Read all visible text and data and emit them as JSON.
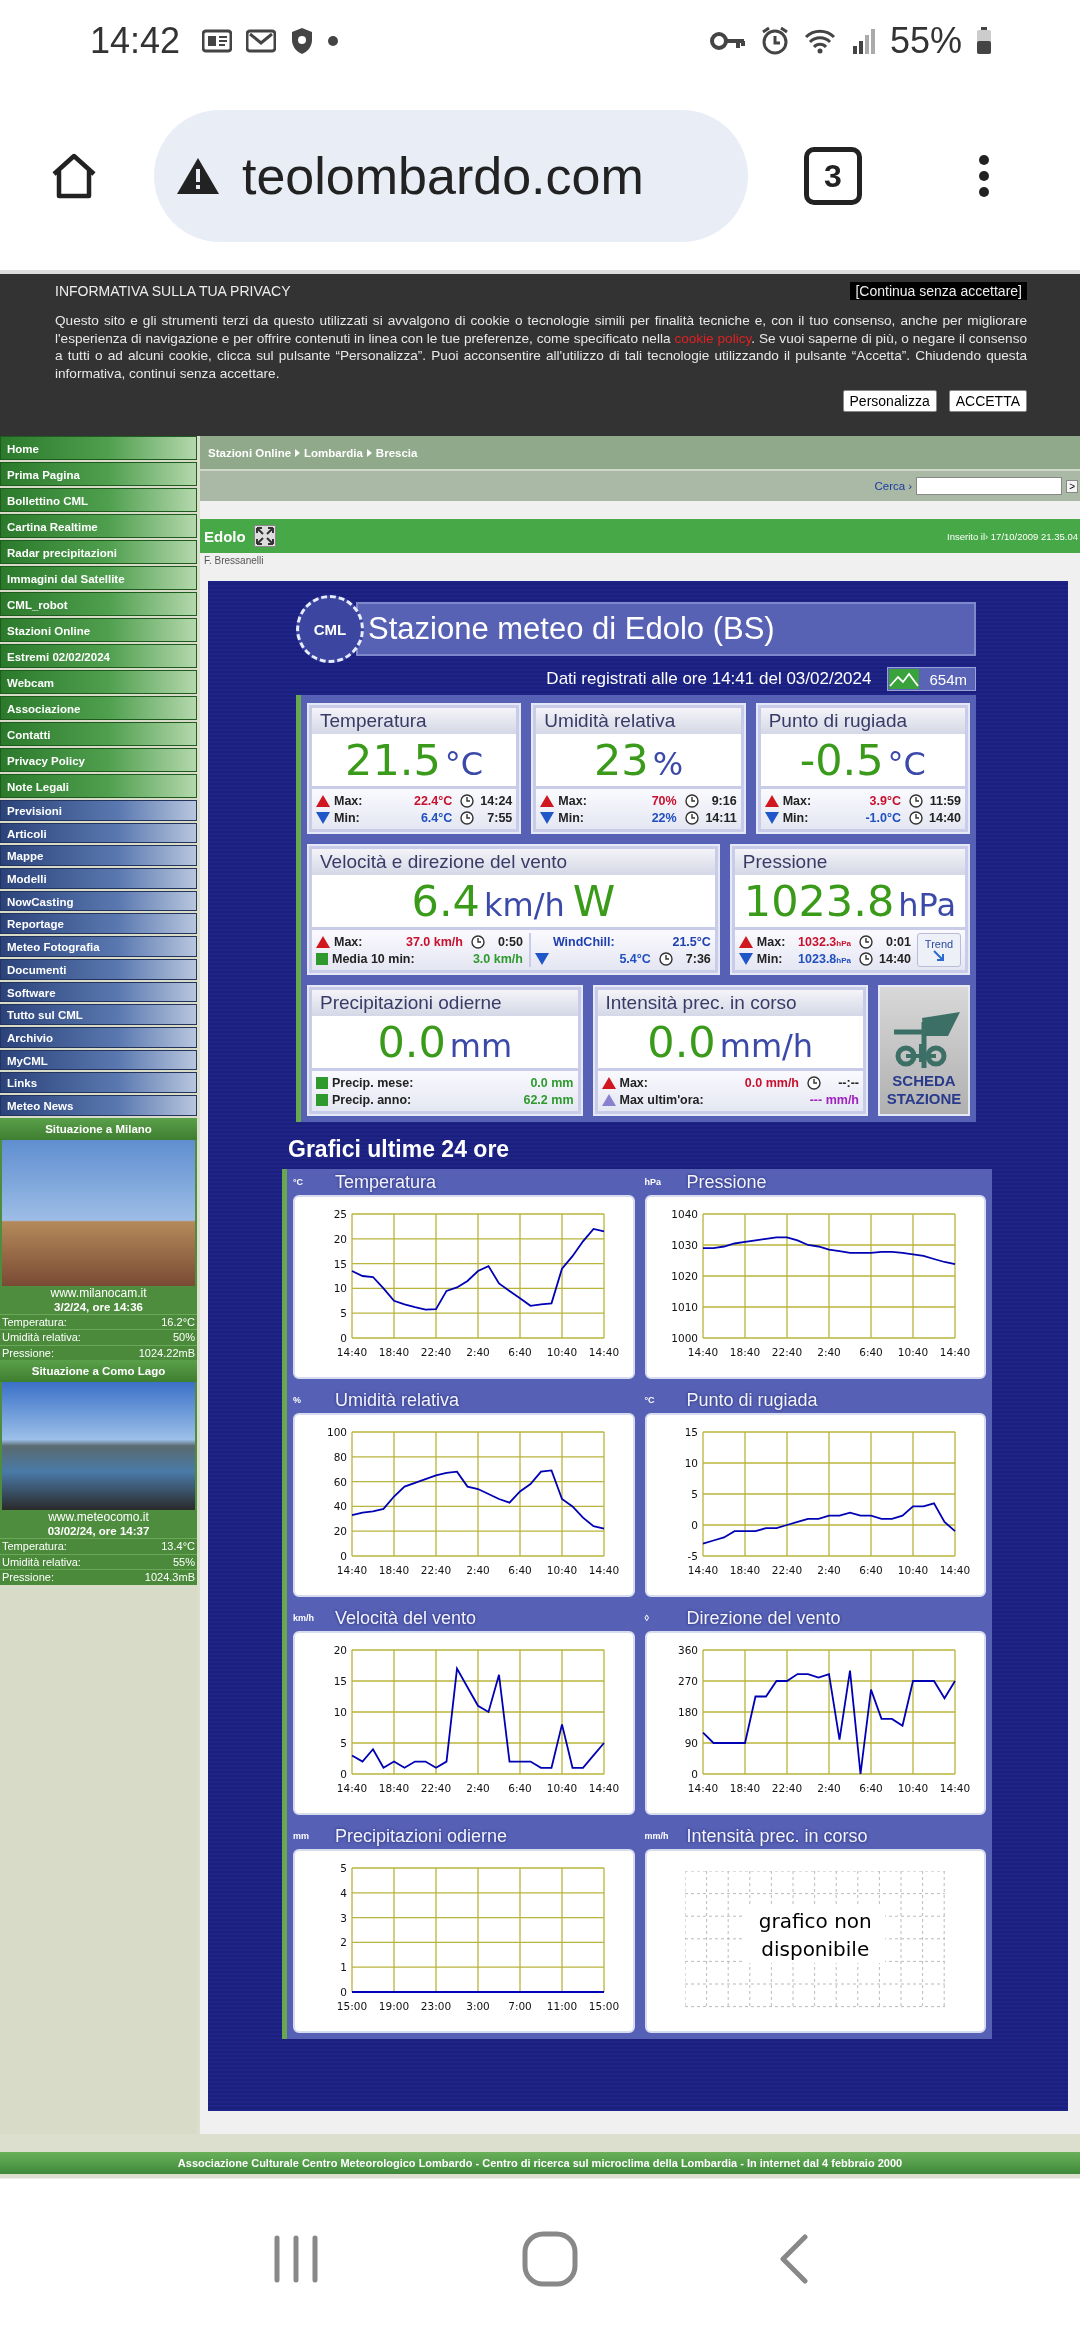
{
  "status_bar": {
    "time": "14:42",
    "battery": "55%"
  },
  "browser": {
    "url": "teolombardo.com",
    "tab_count": "3"
  },
  "privacy_banner": {
    "title": "INFORMATIVA SULLA TUA PRIVACY",
    "dismiss": "[Continua senza accettare]",
    "text_before": "Questo sito e gli strumenti terzi da questo utilizzati si avvalgono di cookie o tecnologie simili per finalità tecniche e, con il tuo consenso, anche per migliorare l'esperienza di navigazione e per offrire contenuti in linea con le tue preferenze, come specificato nella ",
    "link": "cookie policy",
    "text_after": ". Se vuoi saperne di più, o negare il consenso a tutti o ad alcuni cookie, clicca sul pulsante “Personalizza”. Puoi acconsentire all'utilizzo di tali tecnologie utilizzando il pulsante “Accetta”. Chiudendo questa informativa, continui senza accettare.",
    "buttons": [
      "Personalizza",
      "ACCETTA"
    ]
  },
  "sidebar": {
    "menus": [
      {
        "kind": "green",
        "items": [
          "Home",
          "Prima Pagina",
          "Bollettino CML",
          "Cartina Realtime",
          "Radar precipitazioni",
          "Immagini dal Satellite",
          "CML_robot",
          "Stazioni Online",
          "Estremi 02/02/2024",
          "Webcam",
          "Associazione",
          "Contatti",
          "Privacy Policy",
          "Note Legali"
        ]
      },
      {
        "kind": "blue",
        "items": [
          "Previsioni",
          "Articoli",
          "Mappe",
          "Modelli",
          "NowCasting",
          "Reportage",
          "Meteo Fotografia",
          "Documenti",
          "Software",
          "Tutto sul CML",
          "Archivio",
          "MyCML",
          "Links",
          "Meteo News"
        ]
      }
    ],
    "webcams": [
      {
        "title": "Situazione a Milano",
        "site": "www.milanocam.it",
        "datetime": "3/2/24, ore 14:36",
        "readings": [
          {
            "label": "Temperatura:",
            "value": "16.2°C"
          },
          {
            "label": "Umidità relativa:",
            "value": "50%"
          },
          {
            "label": "Pressione:",
            "value": "1024.22mB"
          }
        ]
      },
      {
        "title": "Situazione a Como Lago",
        "site": "www.meteocomo.it",
        "datetime": "03/02/24, ore 14:37",
        "readings": [
          {
            "label": "Temperatura:",
            "value": "13.4°C"
          },
          {
            "label": "Umidità relativa:",
            "value": "55%"
          },
          {
            "label": "Pressione:",
            "value": "1024.3mB"
          }
        ]
      }
    ]
  },
  "breadcrumb": [
    "Stazioni Online",
    "Lombardia",
    "Brescia"
  ],
  "search": {
    "label": "Cerca ›",
    "button": ">"
  },
  "title_bar": {
    "title": "Edolo",
    "inserted": "Inserito il› 17/10/2009 21.35.04"
  },
  "author": "F. Bressanelli",
  "station": {
    "logo": "CML",
    "title": "Stazione meteo di Edolo (BS)",
    "recorded": "Dati registrati alle ore 14:41 del 03/02/2024",
    "altitude": "654m",
    "card_rows": [
      {
        "cards": [
          {
            "kind": "standard",
            "title": "Temperatura",
            "value": "21.5",
            "unit": "°C",
            "stats": [
              {
                "kind": "max",
                "label": "Max:",
                "value": "22.4°C",
                "time": "14:24"
              },
              {
                "kind": "min",
                "label": "Min:",
                "value": "6.4°C",
                "time": "7:55"
              }
            ]
          },
          {
            "kind": "standard",
            "title": "Umidità relativa",
            "value": "23",
            "unit": "%",
            "stats": [
              {
                "kind": "max",
                "label": "Max:",
                "value": "70%",
                "time": "9:16"
              },
              {
                "kind": "min",
                "label": "Min:",
                "value": "22%",
                "time": "14:11"
              }
            ]
          },
          {
            "kind": "standard",
            "title": "Punto di rugiada",
            "value": "-0.5",
            "unit": "°C",
            "stats": [
              {
                "kind": "max",
                "label": "Max:",
                "value": "3.9°C",
                "time": "11:59"
              },
              {
                "kind": "min",
                "label": "Min:",
                "value": "-1.0°C",
                "time": "14:40"
              }
            ]
          }
        ]
      },
      {
        "cards": [
          {
            "kind": "wind",
            "title": "Velocità e direzione del vento",
            "value": "6.4",
            "unit": "km/h",
            "direction": "W",
            "stats": [
              {
                "kind": "max",
                "label": "Max:",
                "value": "37.0 km/h",
                "time": "0:50"
              },
              {
                "kind": "avg",
                "label": "Media 10 min:",
                "value": "3.0 km/h"
              }
            ],
            "side_stats": [
              {
                "kind": "note",
                "label": "WindChill:",
                "value": "21.5°C"
              },
              {
                "kind": "min",
                "value": "5.4°C",
                "time": "7:36"
              }
            ]
          },
          {
            "kind": "pressure",
            "title": "Pressione",
            "value": "1023.8",
            "unit": "hPa",
            "stats": [
              {
                "kind": "max",
                "label": "Max:",
                "value": "1032.3$_{hPa}$",
                "time": "0:01"
              },
              {
                "kind": "min",
                "label": "Min:",
                "value": "1023.8$_{hPa}$",
                "time": "14:40"
              }
            ],
            "trend": "Trend"
          }
        ]
      },
      {
        "cards": [
          {
            "kind": "standard",
            "title": "Precipitazioni odierne",
            "value": "0.0",
            "unit": "mm",
            "stats": [
              {
                "kind": "avg",
                "label": "Precip. mese:",
                "value": "0.0 mm"
              },
              {
                "kind": "avg",
                "label": "Precip. anno:",
                "value": "62.2 mm"
              }
            ]
          },
          {
            "kind": "standard",
            "title": "Intensità prec. in corso",
            "value": "0.0",
            "unit": "mm/h",
            "stats": [
              {
                "kind": "max",
                "label": "Max:",
                "value": "0.0 mm/h",
                "time": "--:--"
              },
              {
                "kind": "recent",
                "label": "Max ultim'ora:",
                "value": "--- mm/h"
              }
            ]
          },
          {
            "kind": "button",
            "label": "SCHEDA STAZIONE"
          }
        ]
      }
    ]
  },
  "charts_title": "Grafici ultime 24 ore",
  "charts": [
    {
      "kind": "chart",
      "title": "Temperatura",
      "unit": "°C",
      "chart_data": {
        "type": "line",
        "grid": true,
        "categories": [
          "14:40",
          null,
          null,
          null,
          "18:40",
          null,
          null,
          null,
          "22:40",
          null,
          null,
          null,
          "2:40",
          null,
          null,
          null,
          "6:40",
          null,
          null,
          null,
          "10:40",
          null,
          null,
          null,
          "14:40"
        ],
        "ylim": [
          0,
          25
        ],
        "yticks": [
          0,
          5,
          10,
          15,
          20,
          25
        ],
        "series": [
          {
            "color": "#0000b4",
            "values": [
              13.5,
              12.5,
              12.3,
              10,
              7.5,
              6.8,
              6.2,
              5.7,
              5.8,
              9.5,
              10.2,
              11.5,
              13.5,
              14.5,
              11,
              9.5,
              8,
              6.5,
              6.8,
              7,
              14,
              16.5,
              19.5,
              22,
              21.5
            ]
          }
        ]
      }
    },
    {
      "kind": "chart",
      "title": "Pressione",
      "unit": "hPa",
      "chart_data": {
        "type": "line",
        "grid": true,
        "categories": [
          "14:40",
          null,
          null,
          null,
          "18:40",
          null,
          null,
          null,
          "22:40",
          null,
          null,
          null,
          "2:40",
          null,
          null,
          null,
          "6:40",
          null,
          null,
          null,
          "10:40",
          null,
          null,
          null,
          "14:40"
        ],
        "ylim": [
          1000,
          1040
        ],
        "yticks": [
          1000,
          1010,
          1020,
          1030,
          1040
        ],
        "series": [
          {
            "color": "#0000b4",
            "values": [
              1029,
              1029,
              1029.5,
              1030.5,
              1031,
              1031.5,
              1032,
              1032.5,
              1032.5,
              1031.5,
              1030,
              1029.5,
              1028.5,
              1028,
              1027.5,
              1027.5,
              1027.5,
              1027.8,
              1027.8,
              1027.5,
              1027,
              1026.5,
              1025.5,
              1024.5,
              1023.8
            ]
          }
        ]
      }
    },
    {
      "kind": "chart",
      "title": "Umidità relativa",
      "unit": "%",
      "chart_data": {
        "type": "line",
        "grid": true,
        "categories": [
          "14:40",
          null,
          null,
          null,
          "18:40",
          null,
          null,
          null,
          "22:40",
          null,
          null,
          null,
          "2:40",
          null,
          null,
          null,
          "6:40",
          null,
          null,
          null,
          "10:40",
          null,
          null,
          null,
          "14:40"
        ],
        "ylim": [
          0,
          100
        ],
        "yticks": [
          0,
          20,
          40,
          60,
          80,
          100
        ],
        "series": [
          {
            "color": "#0000b4",
            "values": [
              33,
              35,
              36,
              38,
              48,
              56,
              59,
              62,
              65,
              67,
              68,
              56,
              54,
              50,
              46,
              43,
              52,
              58,
              68,
              69,
              46,
              40,
              31,
              24,
              22
            ]
          }
        ]
      }
    },
    {
      "kind": "chart",
      "title": "Punto di rugiada",
      "unit": "°C",
      "chart_data": {
        "type": "line",
        "grid": true,
        "categories": [
          "14:40",
          null,
          null,
          null,
          "18:40",
          null,
          null,
          null,
          "22:40",
          null,
          null,
          null,
          "2:40",
          null,
          null,
          null,
          "6:40",
          null,
          null,
          null,
          "10:40",
          null,
          null,
          null,
          "14:40"
        ],
        "ylim": [
          -5,
          15
        ],
        "yticks": [
          -5,
          0,
          5,
          10,
          15
        ],
        "series": [
          {
            "color": "#0000b4",
            "values": [
              -3,
              -2.5,
              -2,
              -1,
              -1,
              -1,
              -0.5,
              -0.5,
              0,
              0.5,
              1,
              1,
              1.5,
              1.5,
              2,
              1.5,
              1.5,
              1,
              1,
              1.5,
              3,
              3,
              3.5,
              0.5,
              -1
            ]
          }
        ]
      }
    },
    {
      "kind": "chart",
      "title": "Velocità del vento",
      "unit": "km/h",
      "chart_data": {
        "type": "line",
        "grid": true,
        "categories": [
          "14:40",
          null,
          null,
          null,
          "18:40",
          null,
          null,
          null,
          "22:40",
          null,
          null,
          null,
          "2:40",
          null,
          null,
          null,
          "6:40",
          null,
          null,
          null,
          "10:40",
          null,
          null,
          null,
          "14:40"
        ],
        "ylim": [
          0,
          20
        ],
        "yticks": [
          0,
          5,
          10,
          15,
          20
        ],
        "series": [
          {
            "color": "#0000b4",
            "values": [
              3,
              2,
              4,
              1,
              2,
              1,
              2,
              2,
              1,
              2,
              17,
              14,
              11,
              10,
              16,
              2,
              2,
              2,
              1,
              1,
              8,
              1,
              1,
              3,
              5
            ]
          }
        ]
      }
    },
    {
      "kind": "chart",
      "title": "Direzione del vento",
      "unit": "◊",
      "chart_data": {
        "type": "line",
        "grid": true,
        "categories": [
          "14:40",
          null,
          null,
          null,
          "18:40",
          null,
          null,
          null,
          "22:40",
          null,
          null,
          null,
          "2:40",
          null,
          null,
          null,
          "6:40",
          null,
          null,
          null,
          "10:40",
          null,
          null,
          null,
          "14:40"
        ],
        "ylim": [
          0,
          360
        ],
        "yticks": [
          0,
          90,
          180,
          270,
          360
        ],
        "series": [
          {
            "color": "#0000b4",
            "values": [
              120,
              90,
              90,
              90,
              90,
              225,
              225,
              270,
              270,
              290,
              290,
              280,
              290,
              100,
              300,
              0,
              245,
              160,
              160,
              140,
              270,
              270,
              270,
              220,
              270
            ]
          }
        ]
      }
    },
    {
      "kind": "chart",
      "title": "Precipitazioni odierne",
      "unit": "mm",
      "chart_data": {
        "type": "line",
        "grid": true,
        "categories": [
          "15:00",
          null,
          null,
          null,
          "19:00",
          null,
          null,
          null,
          "23:00",
          null,
          null,
          null,
          "3:00",
          null,
          null,
          null,
          "7:00",
          null,
          null,
          null,
          "11:00",
          null,
          null,
          null,
          "15:00"
        ],
        "ylim": [
          0,
          5
        ],
        "yticks": [
          0,
          1,
          2,
          3,
          4,
          5
        ],
        "series": [
          {
            "color": "#0000b4",
            "values": [
              0,
              0,
              0,
              0,
              0,
              0,
              0,
              0,
              0,
              0,
              0,
              0,
              0,
              0,
              0,
              0,
              0,
              0,
              0,
              0,
              0,
              0,
              0,
              0,
              0
            ]
          }
        ]
      }
    },
    {
      "kind": "unavailable",
      "title": "Intensità prec. in corso",
      "unit": "mm/h",
      "message": "grafico non disponibile"
    }
  ],
  "footer": "Associazione Culturale Centro Meteorologico Lombardo - Centro di ricerca sul microclima della Lombardia - In internet dal 4 febbraio 2000"
}
